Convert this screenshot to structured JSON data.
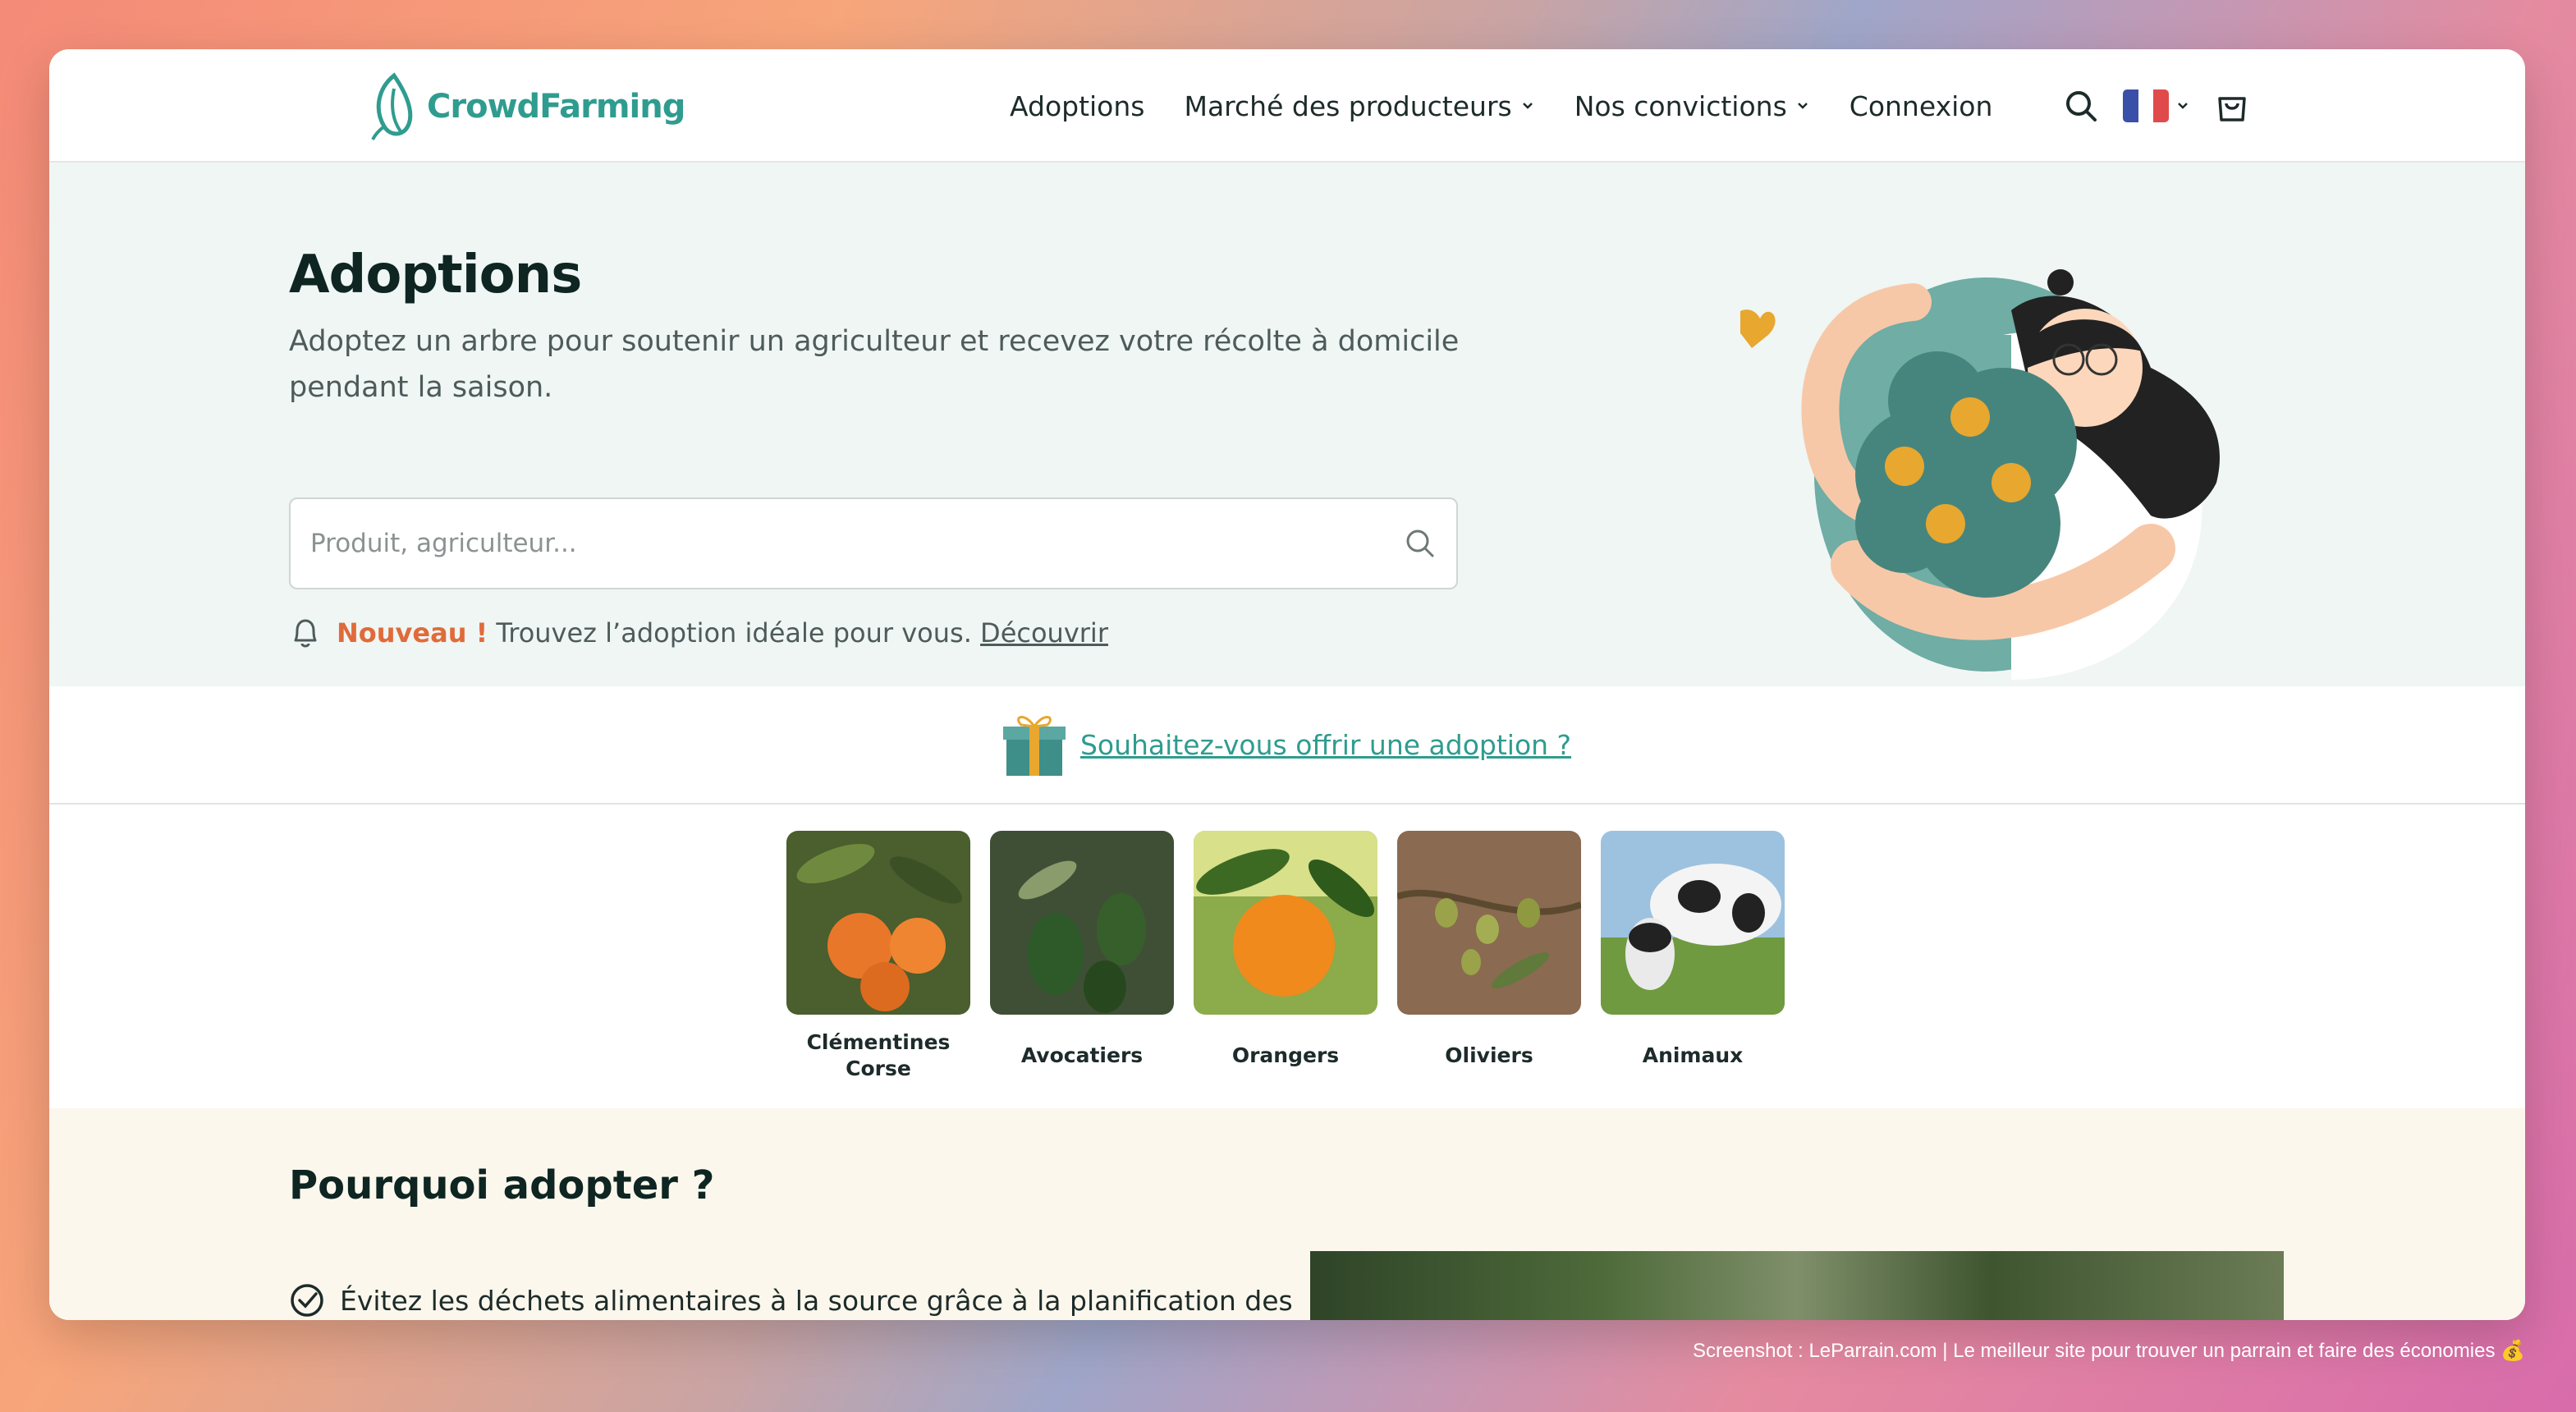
{
  "brand": {
    "name": "CrowdFarming",
    "accent": "#2f9c8f"
  },
  "nav": {
    "items": [
      {
        "label": "Adoptions",
        "dropdown": false
      },
      {
        "label": "Marché des producteurs",
        "dropdown": true
      },
      {
        "label": "Nos convictions",
        "dropdown": true
      },
      {
        "label": "Connexion",
        "dropdown": false
      }
    ],
    "icons": [
      "search-icon",
      "flag-fr-icon",
      "cart-icon"
    ]
  },
  "hero": {
    "title": "Adoptions",
    "subtitle": "Adoptez un arbre pour soutenir un agriculteur et recevez votre récolte à domicile pendant la saison.",
    "search_placeholder": "Produit, agriculteur...",
    "notice_badge": "Nouveau !",
    "notice_text": "Trouvez l’adoption idéale pour vous.",
    "notice_link": "Découvrir"
  },
  "gift": {
    "link": "Souhaitez-vous offrir une adoption ?"
  },
  "categories": [
    {
      "label": "Clémentines Corse"
    },
    {
      "label": "Avocatiers"
    },
    {
      "label": "Orangers"
    },
    {
      "label": "Oliviers"
    },
    {
      "label": "Animaux"
    }
  ],
  "why": {
    "title": "Pourquoi adopter ?",
    "items": [
      "Évitez les déchets alimentaires à la source grâce à la planification des"
    ]
  },
  "credit": "Screenshot : LeParrain.com | Le meilleur site pour trouver un parrain et faire des économies 💰"
}
